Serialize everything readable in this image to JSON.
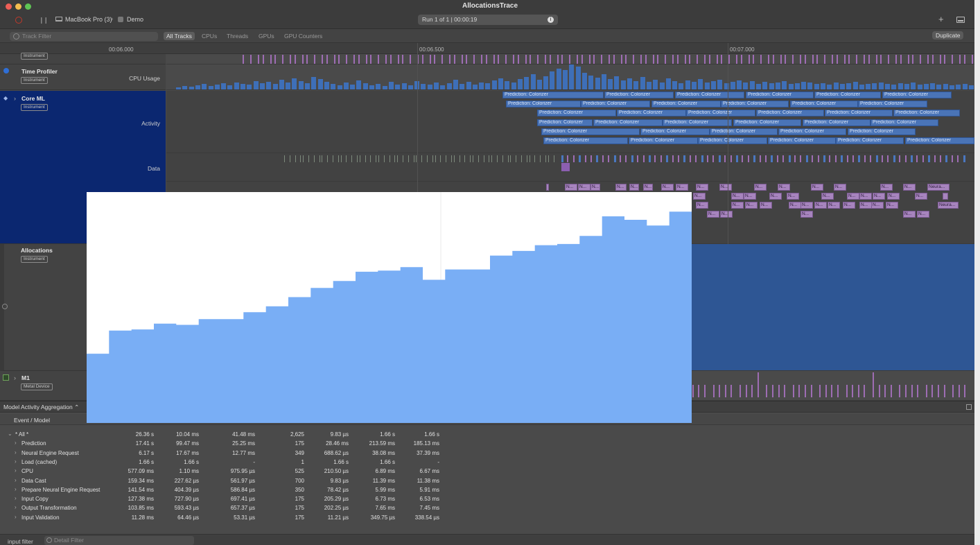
{
  "window": {
    "title": "AllocationsTrace",
    "device": "MacBook Pro (3)",
    "target": "Demo",
    "run": "Run 1 of 1  |  00:00:19"
  },
  "filterbar": {
    "placeholder": "Track Filter",
    "scopes": [
      "All Tracks",
      "CPUs",
      "Threads",
      "GPUs",
      "GPU Counters"
    ],
    "duplicate": "Duplicate"
  },
  "ruler": {
    "ticks": [
      "00:06.000",
      "00:06.500",
      "00:07.000"
    ]
  },
  "tracks": {
    "partial_badge": "Instrument",
    "time_profiler": {
      "name": "Time Profiler",
      "badge": "Instrument",
      "lane": "CPU Usage"
    },
    "coreml": {
      "name": "Core ML",
      "badge": "Instrument",
      "lanes": [
        "Activity",
        "Data"
      ]
    },
    "allocations": {
      "name": "Allocations",
      "badge": "Instrument"
    },
    "m1": {
      "name": "M1",
      "badge": "Metal Device"
    }
  },
  "prediction_label": "Prediction: Colorizer",
  "neural_labels": {
    "short": "N...",
    "long": "Neura..."
  },
  "detail": {
    "aggregation": "Model Activity Aggregation",
    "column": "Event / Model",
    "rows": [
      {
        "name": "* All *",
        "values": [
          "26.36 s",
          "10.04 ms",
          "41.48 ms",
          "2,625",
          "9.83 µs",
          "1.66 s",
          "1.66 s"
        ]
      },
      {
        "name": "Prediction",
        "values": [
          "17.41 s",
          "99.47 ms",
          "25.25 ms",
          "175",
          "28.46 ms",
          "213.59 ms",
          "185.13 ms"
        ]
      },
      {
        "name": "Neural Engine Request",
        "values": [
          "6.17 s",
          "17.67 ms",
          "12.77 ms",
          "349",
          "688.62 µs",
          "38.08 ms",
          "37.39 ms"
        ]
      },
      {
        "name": "Load (cached)",
        "values": [
          "1.66 s",
          "1.66 s",
          "-",
          "1",
          "1.66 s",
          "1.66 s",
          "-"
        ]
      },
      {
        "name": "CPU",
        "values": [
          "577.09 ms",
          "1.10 ms",
          "975.95 µs",
          "525",
          "210.50 µs",
          "6.89 ms",
          "6.67 ms"
        ]
      },
      {
        "name": "Data Cast",
        "values": [
          "159.34 ms",
          "227.62 µs",
          "561.97 µs",
          "700",
          "9.83 µs",
          "11.39 ms",
          "11.38 ms"
        ]
      },
      {
        "name": "Prepare Neural Engine Request",
        "values": [
          "141.54 ms",
          "404.39 µs",
          "586.84 µs",
          "350",
          "78.42 µs",
          "5.99 ms",
          "5.91 ms"
        ]
      },
      {
        "name": "Input Copy",
        "values": [
          "127.38 ms",
          "727.90 µs",
          "697.41 µs",
          "175",
          "205.29 µs",
          "6.73 ms",
          "6.53 ms"
        ]
      },
      {
        "name": "Output Transformation",
        "values": [
          "103.85 ms",
          "593.43 µs",
          "657.37 µs",
          "175",
          "202.25 µs",
          "7.65 ms",
          "7.45 ms"
        ]
      },
      {
        "name": "Input Validation",
        "values": [
          "11.28 ms",
          "64.46 µs",
          "53.31 µs",
          "175",
          "11.21 µs",
          "349.75 µs",
          "338.54 µs"
        ]
      }
    ]
  },
  "bottom": {
    "input_filter": "input filter",
    "detail_filter": "Detail Filter"
  },
  "overlay_chart": {
    "type": "area",
    "step": true,
    "fill": "#79aef5",
    "steps": [
      0.3,
      0.4,
      0.405,
      0.43,
      0.425,
      0.45,
      0.45,
      0.48,
      0.505,
      0.545,
      0.585,
      0.615,
      0.655,
      0.66,
      0.675,
      0.62,
      0.665,
      0.665,
      0.725,
      0.745,
      0.77,
      0.775,
      0.81,
      0.895,
      0.88,
      0.855,
      0.915
    ]
  }
}
